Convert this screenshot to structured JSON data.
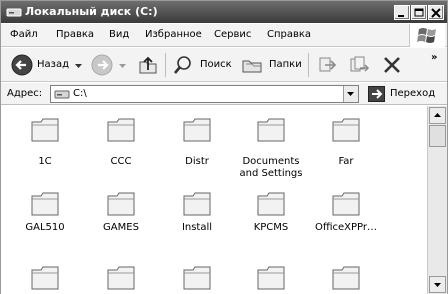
{
  "window": {
    "title": "Локальный диск (C:)"
  },
  "menu": [
    "Файл",
    "Правка",
    "Вид",
    "Избранное",
    "Сервис",
    "Справка"
  ],
  "toolbar": {
    "back_label": "Назад",
    "search_label": "Поиск",
    "folders_label": "Папки",
    "more_glyph": "»"
  },
  "address": {
    "label": "Адрес:",
    "value": "C:\\",
    "go_label": "Переход"
  },
  "folders": [
    "1C",
    "CCC",
    "Distr",
    "Documents and Settings",
    "Far",
    "GAL510",
    "GAMES",
    "Install",
    "KPCMS",
    "OfficeXPPr…",
    "",
    "",
    "",
    "",
    ""
  ]
}
